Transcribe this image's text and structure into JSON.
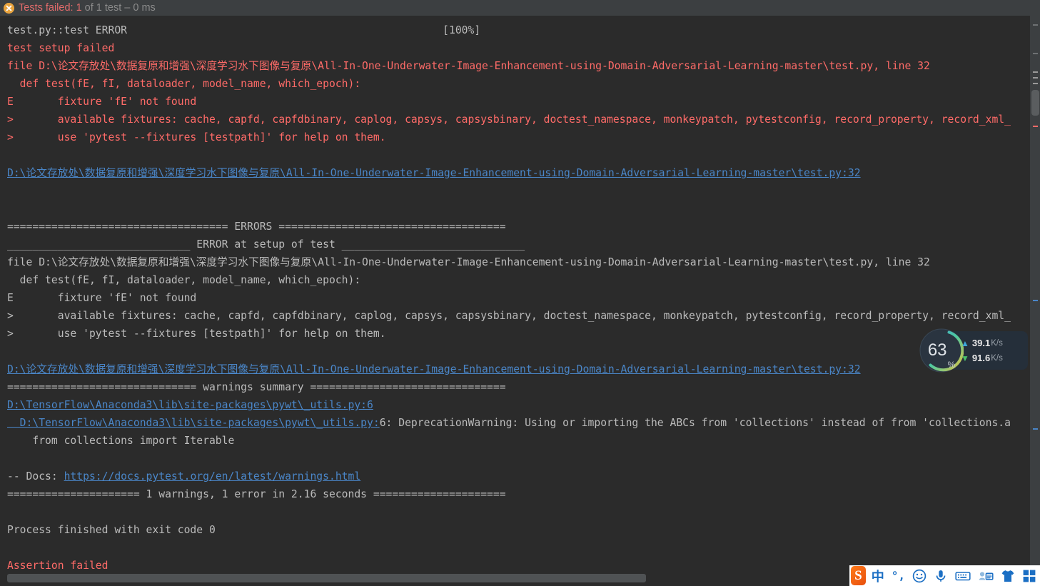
{
  "header": {
    "status_icon": "error-circle-icon",
    "failed_label": "Tests failed:",
    "failed_count": "1",
    "rest": "of 1 test – 0 ms",
    "fail_color": "#e26b6b",
    "dim_color": "#8b8b8b",
    "badge_color": "#e8a33d"
  },
  "console": {
    "colors": {
      "background": "#2b2b2b",
      "default_text": "#bbbbbb",
      "error_text": "#ff6b68",
      "link_text": "#4a86c8"
    },
    "lines": [
      {
        "type": "plain",
        "text": "test.py::test ERROR                                                  [100%]"
      },
      {
        "type": "error",
        "text": "test setup failed"
      },
      {
        "type": "error",
        "text": "file D:\\论文存放处\\数据复原和增强\\深度学习水下图像与复原\\All-In-One-Underwater-Image-Enhancement-using-Domain-Adversarial-Learning-master\\test.py, line 32"
      },
      {
        "type": "error",
        "text": "  def test(fE, fI, dataloader, model_name, which_epoch):"
      },
      {
        "type": "error",
        "text": "E       fixture 'fE' not found"
      },
      {
        "type": "error",
        "text": ">       available fixtures: cache, capfd, capfdbinary, caplog, capsys, capsysbinary, doctest_namespace, monkeypatch, pytestconfig, record_property, record_xml_"
      },
      {
        "type": "error",
        "text": ">       use 'pytest --fixtures [testpath]' for help on them."
      },
      {
        "type": "blank",
        "text": ""
      },
      {
        "type": "link",
        "text": "D:\\论文存放处\\数据复原和增强\\深度学习水下图像与复原\\All-In-One-Underwater-Image-Enhancement-using-Domain-Adversarial-Learning-master\\test.py:32"
      },
      {
        "type": "blank",
        "text": ""
      },
      {
        "type": "blank",
        "text": ""
      },
      {
        "type": "plain",
        "text": "=================================== ERRORS ===================================="
      },
      {
        "type": "plain",
        "text": "_____________________________ ERROR at setup of test _____________________________"
      },
      {
        "type": "plain",
        "text": "file D:\\论文存放处\\数据复原和增强\\深度学习水下图像与复原\\All-In-One-Underwater-Image-Enhancement-using-Domain-Adversarial-Learning-master\\test.py, line 32"
      },
      {
        "type": "plain",
        "text": "  def test(fE, fI, dataloader, model_name, which_epoch):"
      },
      {
        "type": "plain",
        "text": "E       fixture 'fE' not found"
      },
      {
        "type": "plain",
        "text": ">       available fixtures: cache, capfd, capfdbinary, caplog, capsys, capsysbinary, doctest_namespace, monkeypatch, pytestconfig, record_property, record_xml_"
      },
      {
        "type": "plain",
        "text": ">       use 'pytest --fixtures [testpath]' for help on them."
      },
      {
        "type": "blank",
        "text": ""
      },
      {
        "type": "link",
        "text": "D:\\论文存放处\\数据复原和增强\\深度学习水下图像与复原\\All-In-One-Underwater-Image-Enhancement-using-Domain-Adversarial-Learning-master\\test.py:32"
      },
      {
        "type": "plain",
        "text": "============================== warnings summary ==============================="
      },
      {
        "type": "link",
        "text": "D:\\TensorFlow\\Anaconda3\\lib\\site-packages\\pywt\\_utils.py:6"
      },
      {
        "type": "mixed_warning",
        "link_part": "  D:\\TensorFlow\\Anaconda3\\lib\\site-packages\\pywt\\_utils.py:",
        "plain_part": "6: DeprecationWarning: Using or importing the ABCs from 'collections' instead of from 'collections.a"
      },
      {
        "type": "plain",
        "text": "    from collections import Iterable"
      },
      {
        "type": "blank",
        "text": ""
      },
      {
        "type": "docs_line",
        "prefix": "-- Docs: ",
        "url": "https://docs.pytest.org/en/latest/warnings.html"
      },
      {
        "type": "plain",
        "text": "===================== 1 warnings, 1 error in 2.16 seconds ====================="
      },
      {
        "type": "blank",
        "text": ""
      },
      {
        "type": "plain",
        "text": "Process finished with exit code 0"
      },
      {
        "type": "blank",
        "text": ""
      },
      {
        "type": "error",
        "text": "Assertion failed"
      }
    ]
  },
  "netmon": {
    "percent_value": "63",
    "percent_symbol": "%",
    "upload_arrow": "arrow-up-icon",
    "upload_value": "39.1",
    "upload_unit": "K/s",
    "download_arrow": "arrow-down-icon",
    "download_value": "91.6",
    "download_unit": "K/s",
    "ring_colors": [
      "#4ec9a0",
      "#e0c341",
      "#3ea6d8"
    ],
    "upload_color": "#3ea6d8",
    "download_color": "#4cbf6a"
  },
  "ime_bar": {
    "logo_label": "S",
    "items": [
      {
        "name": "sogou-logo-icon",
        "glyph": "S"
      },
      {
        "name": "language-mode-icon",
        "glyph": "中"
      },
      {
        "name": "punctuation-mode-icon",
        "glyph": "°,"
      },
      {
        "name": "emoji-icon",
        "glyph": "☺"
      },
      {
        "name": "voice-input-icon",
        "glyph": "mic"
      },
      {
        "name": "soft-keyboard-icon",
        "glyph": "keyboard"
      },
      {
        "name": "handwriting-icon",
        "glyph": "card"
      },
      {
        "name": "skin-icon",
        "glyph": "shirt"
      },
      {
        "name": "toolbox-icon",
        "glyph": "grid"
      }
    ]
  },
  "scrollbars": {
    "vertical_thumb_label": "vertical-scrollbar-thumb",
    "horizontal_thumb_label": "horizontal-scrollbar-thumb"
  }
}
